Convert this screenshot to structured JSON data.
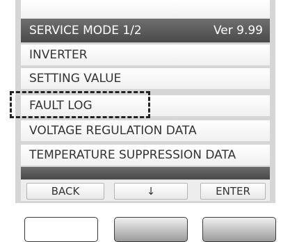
{
  "header": {
    "title": "SERVICE MODE 1/2",
    "version": "Ver 9.99"
  },
  "menu": {
    "items": [
      {
        "label": "INVERTER"
      },
      {
        "label": "SETTING VALUE"
      },
      {
        "label": "FAULT LOG"
      },
      {
        "label": "VOLTAGE REGULATION DATA"
      },
      {
        "label": "TEMPERATURE SUPPRESSION DATA"
      }
    ],
    "highlighted_item": "FAULT LOG"
  },
  "softkeys": {
    "back": "BACK",
    "down": "↓",
    "enter": "ENTER"
  },
  "colors": {
    "header_bg": "#595959",
    "highlight_border": "#222222"
  }
}
